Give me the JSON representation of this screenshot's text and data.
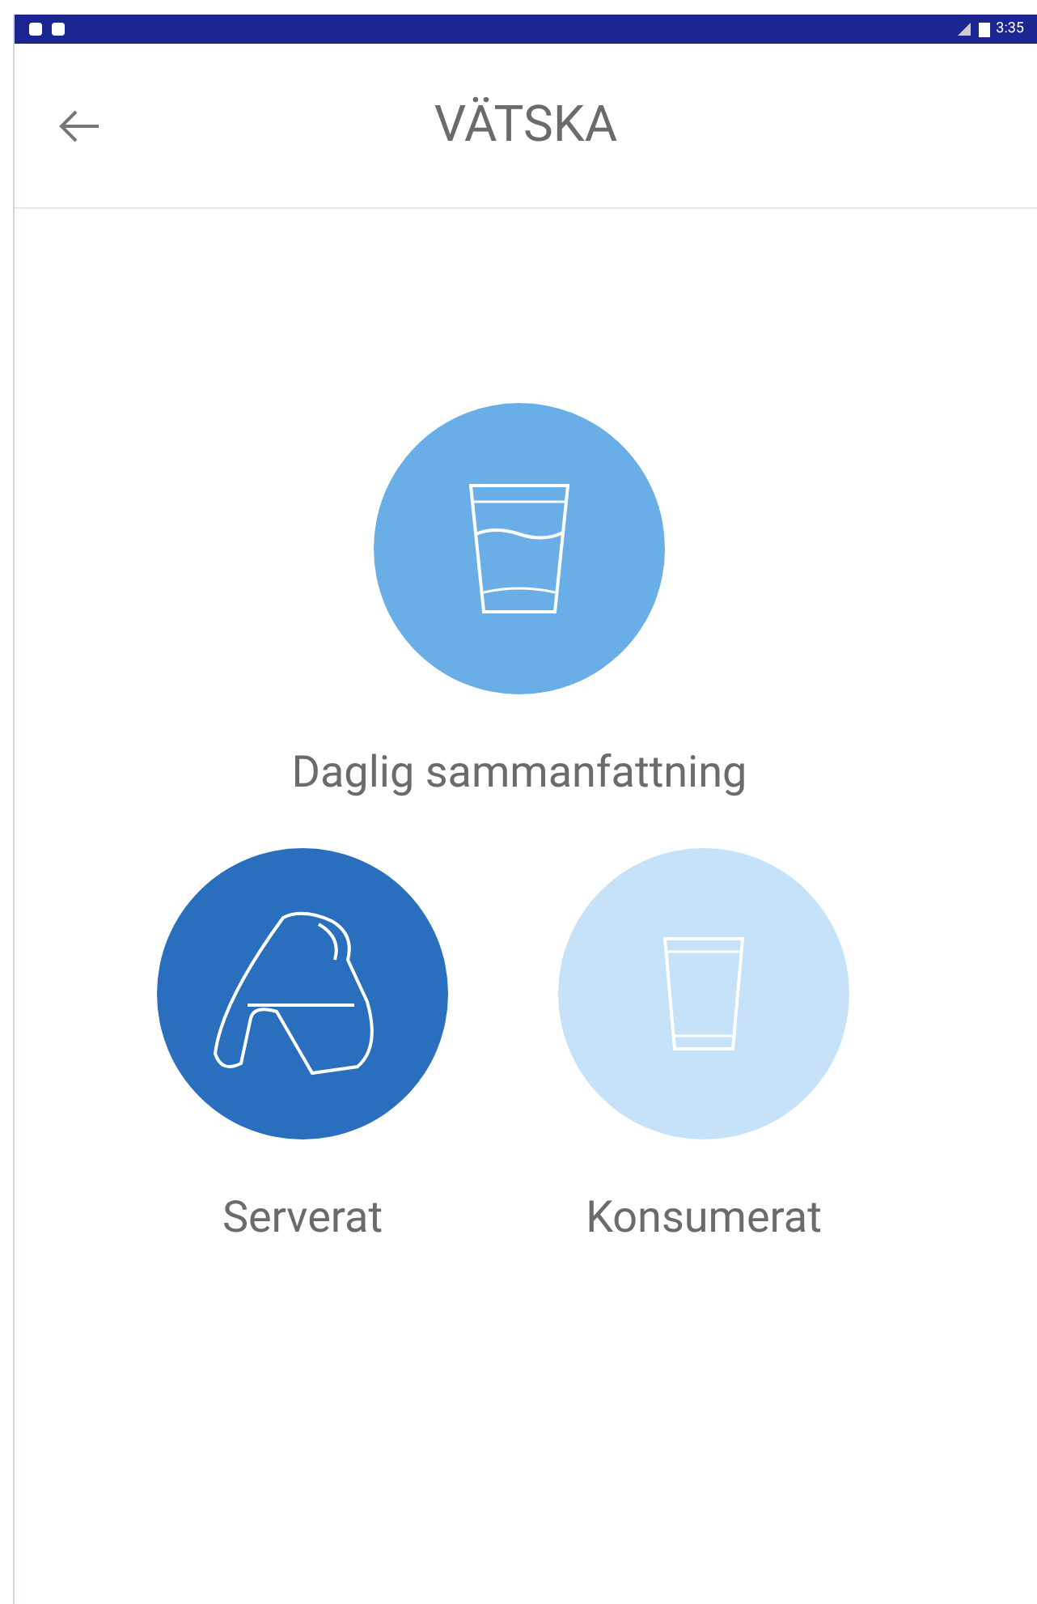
{
  "status_bar": {
    "time": "3:35"
  },
  "header": {
    "title": "VÄTSKA"
  },
  "tiles": [
    {
      "kind": "glass-full",
      "label": "Daglig sammanfattning",
      "color": "#6aaee8"
    },
    {
      "kind": "pitcher",
      "label": "Serverat",
      "color": "#2a6fbd"
    },
    {
      "kind": "glass-empty",
      "label": "Konsumerat",
      "color": "#c6e2f8"
    }
  ]
}
